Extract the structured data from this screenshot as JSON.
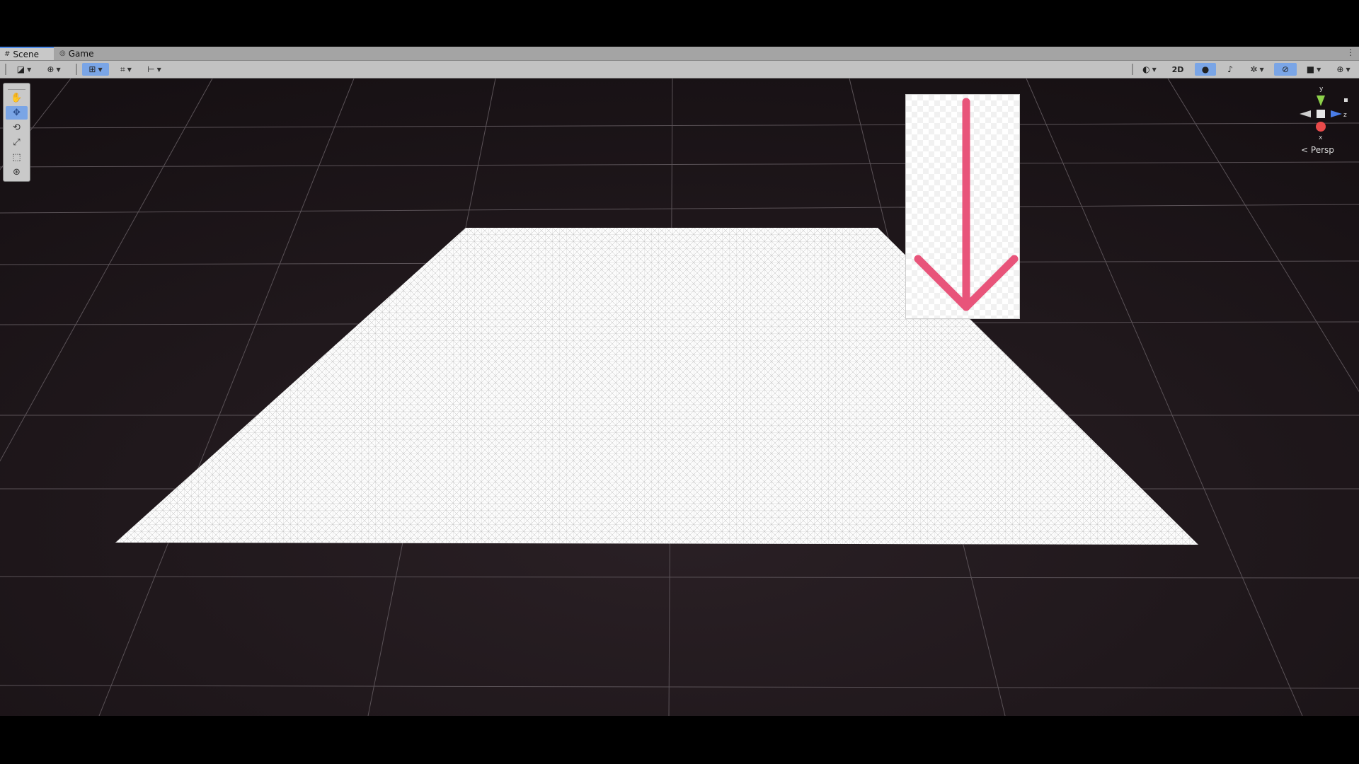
{
  "tabs": [
    {
      "label": "Scene",
      "icon": "grid-icon",
      "active": true
    },
    {
      "label": "Game",
      "icon": "gamepad-icon",
      "active": false
    }
  ],
  "tabbar_menu_icon": "kebab-menu-icon",
  "toolbar": {
    "left": [
      "shading-mode",
      "draw-mode",
      "move-snap",
      "grid-snap",
      "increment-snap"
    ],
    "right": [
      "shading-sphere",
      "2d-toggle",
      "lighting-toggle",
      "audio-toggle",
      "effects-toggle",
      "hidden-objects",
      "camera-settings",
      "gizmos"
    ],
    "two_d_label": "2D"
  },
  "tools": [
    "hand-tool",
    "move-tool",
    "rotate-tool",
    "scale-tool",
    "rect-tool",
    "transform-tool"
  ],
  "active_tool": "move-tool",
  "gizmo": {
    "y_label": "y",
    "z_label": "z",
    "x_label": "x",
    "projection_label": "Persp"
  },
  "colors": {
    "accent": "#4d8ae8",
    "toggle_on": "#7aa5e6",
    "scene_bg": "#1c1519",
    "arrow": "#e8547a",
    "axis_y": "#8dd14a",
    "axis_z": "#4a7de8",
    "axis_x": "#e84a4a"
  }
}
